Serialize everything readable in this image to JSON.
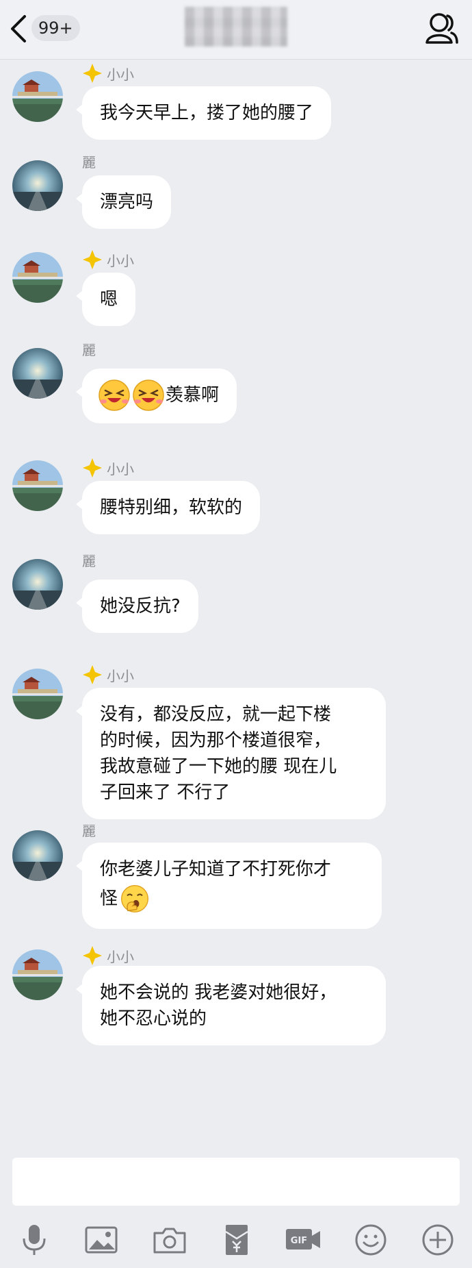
{
  "header": {
    "unread_count": "99+"
  },
  "contacts": {
    "a": {
      "name": "小小"
    },
    "b": {
      "name": "麗"
    }
  },
  "messages": [
    {
      "sender": "小小",
      "text": "我今天早上，搂了她的腰了"
    },
    {
      "sender": "麗",
      "text": "漂亮吗"
    },
    {
      "sender": "小小",
      "text": "嗯"
    },
    {
      "sender": "麗",
      "text": "羡慕啊",
      "emojis": [
        "laughing-crying-emoji",
        "laughing-crying-emoji"
      ]
    },
    {
      "sender": "小小",
      "text": "腰特别细，软软的"
    },
    {
      "sender": "麗",
      "text": "她没反抗?"
    },
    {
      "sender": "小小",
      "lines": [
        "没有，都没反应，就一起下楼",
        "的时候，因为那个楼道很窄，",
        "我故意碰了一下她的腰 现在儿",
        "子回来了 不行了"
      ]
    },
    {
      "sender": "麗",
      "lines": [
        "你老婆儿子知道了不打死你才",
        "怪"
      ],
      "emojis": [
        "yawn-emoji"
      ]
    },
    {
      "sender": "小小",
      "lines": [
        "她不会说的 我老婆对她很好，",
        "她不忍心说的"
      ]
    }
  ],
  "toolbar": {
    "icons": [
      "microphone-icon",
      "image-icon",
      "camera-icon",
      "red-packet-icon",
      "gif-icon",
      "emoji-icon",
      "plus-icon"
    ]
  },
  "colors": {
    "background": "#ECEDF1",
    "bubble": "#FFFFFF",
    "sender_name": "#8B8C90",
    "badge": "#F5C400"
  }
}
